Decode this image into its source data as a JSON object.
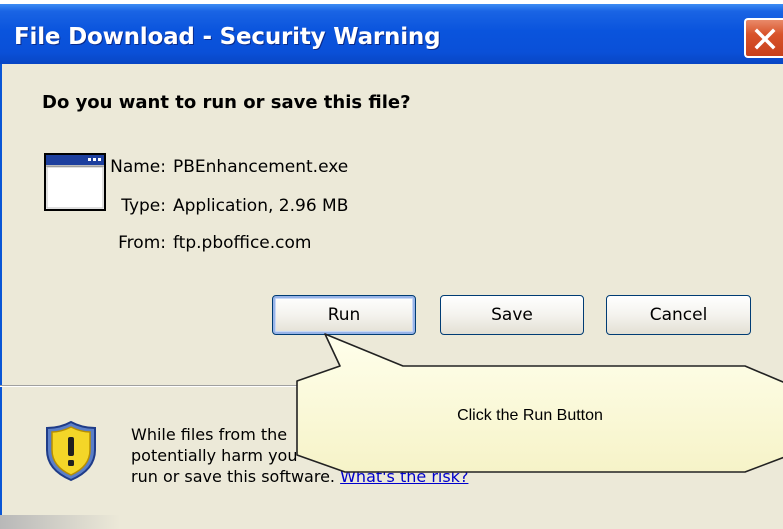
{
  "window": {
    "title": "File Download - Security Warning",
    "close_icon": "close-x-icon"
  },
  "dialog": {
    "question": "Do you want to run or save this file?",
    "file_icon": "application-window-icon",
    "name_label": "Name:",
    "name_value": "PBEnhancement.exe",
    "type_label": "Type:",
    "type_value": "Application, 2.96 MB",
    "from_label": "From:",
    "from_value": "ftp.pboffice.com"
  },
  "buttons": {
    "run": "Run",
    "save": "Save",
    "cancel": "Cancel"
  },
  "warning": {
    "icon": "security-shield-icon",
    "line1": "While files from the",
    "line2": "potentially harm you",
    "line3": "run or save this software.",
    "risk_link": "What's the risk?"
  },
  "callout": {
    "text": "Click the Run Button"
  },
  "colors": {
    "titlebar": "#0a54dd",
    "dialog_bg": "#ece9d8",
    "close_button": "#d8532a",
    "callout_fill": "#fffde4",
    "link": "#0000cc"
  }
}
